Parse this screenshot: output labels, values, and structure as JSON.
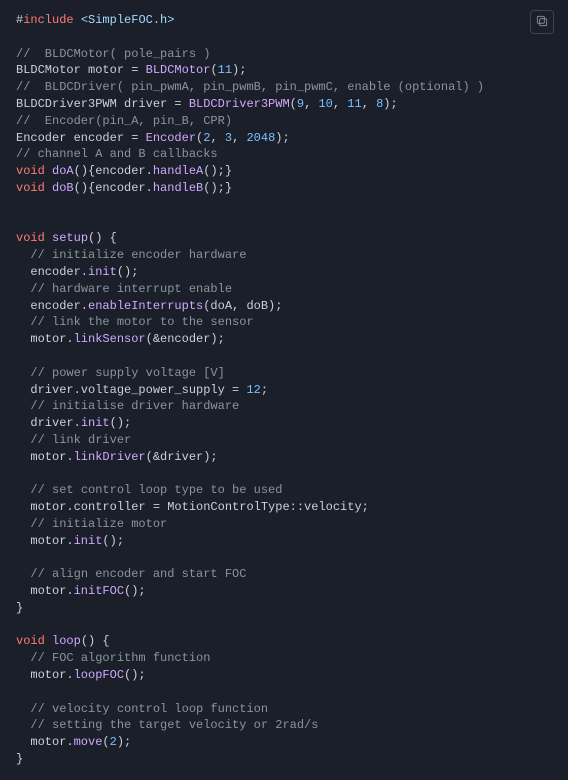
{
  "lines": [
    [
      [
        "pln",
        "#"
      ],
      [
        "kw-red",
        "include"
      ],
      [
        "pln",
        " "
      ],
      [
        "str-blue",
        "<SimpleFOC.h>"
      ]
    ],
    [],
    [
      [
        "cmt",
        "//  BLDCMotor( pole_pairs )"
      ]
    ],
    [
      [
        "pln",
        "BLDCMotor motor = "
      ],
      [
        "fn-purp",
        "BLDCMotor"
      ],
      [
        "pln",
        "("
      ],
      [
        "num",
        "11"
      ],
      [
        "pln",
        ");"
      ]
    ],
    [
      [
        "cmt",
        "//  BLDCDriver( pin_pwmA, pin_pwmB, pin_pwmC, enable (optional) )"
      ]
    ],
    [
      [
        "pln",
        "BLDCDriver3PWM driver = "
      ],
      [
        "fn-purp",
        "BLDCDriver3PWM"
      ],
      [
        "pln",
        "("
      ],
      [
        "num",
        "9"
      ],
      [
        "pln",
        ", "
      ],
      [
        "num",
        "10"
      ],
      [
        "pln",
        ", "
      ],
      [
        "num",
        "11"
      ],
      [
        "pln",
        ", "
      ],
      [
        "num",
        "8"
      ],
      [
        "pln",
        ");"
      ]
    ],
    [
      [
        "cmt",
        "//  Encoder(pin_A, pin_B, CPR)"
      ]
    ],
    [
      [
        "pln",
        "Encoder encoder = "
      ],
      [
        "fn-purp",
        "Encoder"
      ],
      [
        "pln",
        "("
      ],
      [
        "num",
        "2"
      ],
      [
        "pln",
        ", "
      ],
      [
        "num",
        "3"
      ],
      [
        "pln",
        ", "
      ],
      [
        "num",
        "2048"
      ],
      [
        "pln",
        ");"
      ]
    ],
    [
      [
        "cmt",
        "// channel A and B callbacks"
      ]
    ],
    [
      [
        "kw-red",
        "void"
      ],
      [
        "pln",
        " "
      ],
      [
        "fn-purp",
        "doA"
      ],
      [
        "pln",
        "(){encoder."
      ],
      [
        "fn-purp",
        "handleA"
      ],
      [
        "pln",
        "();}"
      ]
    ],
    [
      [
        "kw-red",
        "void"
      ],
      [
        "pln",
        " "
      ],
      [
        "fn-purp",
        "doB"
      ],
      [
        "pln",
        "(){encoder."
      ],
      [
        "fn-purp",
        "handleB"
      ],
      [
        "pln",
        "();}"
      ]
    ],
    [],
    [],
    [
      [
        "kw-red",
        "void"
      ],
      [
        "pln",
        " "
      ],
      [
        "fn-purp",
        "setup"
      ],
      [
        "pln",
        "() {"
      ]
    ],
    [
      [
        "pln",
        "  "
      ],
      [
        "cmt",
        "// initialize encoder hardware"
      ]
    ],
    [
      [
        "pln",
        "  encoder."
      ],
      [
        "fn-purp",
        "init"
      ],
      [
        "pln",
        "();"
      ]
    ],
    [
      [
        "pln",
        "  "
      ],
      [
        "cmt",
        "// hardware interrupt enable"
      ]
    ],
    [
      [
        "pln",
        "  encoder."
      ],
      [
        "fn-purp",
        "enableInterrupts"
      ],
      [
        "pln",
        "(doA, doB);"
      ]
    ],
    [
      [
        "pln",
        "  "
      ],
      [
        "cmt",
        "// link the motor to the sensor"
      ]
    ],
    [
      [
        "pln",
        "  motor."
      ],
      [
        "fn-purp",
        "linkSensor"
      ],
      [
        "pln",
        "(&encoder);"
      ]
    ],
    [],
    [
      [
        "pln",
        "  "
      ],
      [
        "cmt",
        "// power supply voltage [V]"
      ]
    ],
    [
      [
        "pln",
        "  driver.voltage_power_supply = "
      ],
      [
        "num",
        "12"
      ],
      [
        "pln",
        ";"
      ]
    ],
    [
      [
        "pln",
        "  "
      ],
      [
        "cmt",
        "// initialise driver hardware"
      ]
    ],
    [
      [
        "pln",
        "  driver."
      ],
      [
        "fn-purp",
        "init"
      ],
      [
        "pln",
        "();"
      ]
    ],
    [
      [
        "pln",
        "  "
      ],
      [
        "cmt",
        "// link driver"
      ]
    ],
    [
      [
        "pln",
        "  motor."
      ],
      [
        "fn-purp",
        "linkDriver"
      ],
      [
        "pln",
        "(&driver);"
      ]
    ],
    [],
    [
      [
        "pln",
        "  "
      ],
      [
        "cmt",
        "// set control loop type to be used"
      ]
    ],
    [
      [
        "pln",
        "  motor.controller = MotionControlType::velocity;"
      ]
    ],
    [
      [
        "pln",
        "  "
      ],
      [
        "cmt",
        "// initialize motor"
      ]
    ],
    [
      [
        "pln",
        "  motor."
      ],
      [
        "fn-purp",
        "init"
      ],
      [
        "pln",
        "();"
      ]
    ],
    [],
    [
      [
        "pln",
        "  "
      ],
      [
        "cmt",
        "// align encoder and start FOC"
      ]
    ],
    [
      [
        "pln",
        "  motor."
      ],
      [
        "fn-purp",
        "initFOC"
      ],
      [
        "pln",
        "();"
      ]
    ],
    [
      [
        "pln",
        "}"
      ]
    ],
    [],
    [
      [
        "kw-red",
        "void"
      ],
      [
        "pln",
        " "
      ],
      [
        "fn-purp",
        "loop"
      ],
      [
        "pln",
        "() {"
      ]
    ],
    [
      [
        "pln",
        "  "
      ],
      [
        "cmt",
        "// FOC algorithm function"
      ]
    ],
    [
      [
        "pln",
        "  motor."
      ],
      [
        "fn-purp",
        "loopFOC"
      ],
      [
        "pln",
        "();"
      ]
    ],
    [],
    [
      [
        "pln",
        "  "
      ],
      [
        "cmt",
        "// velocity control loop function"
      ]
    ],
    [
      [
        "pln",
        "  "
      ],
      [
        "cmt",
        "// setting the target velocity or 2rad/s"
      ]
    ],
    [
      [
        "pln",
        "  motor."
      ],
      [
        "fn-purp",
        "move"
      ],
      [
        "pln",
        "("
      ],
      [
        "num",
        "2"
      ],
      [
        "pln",
        ");"
      ]
    ],
    [
      [
        "pln",
        "}"
      ]
    ]
  ]
}
